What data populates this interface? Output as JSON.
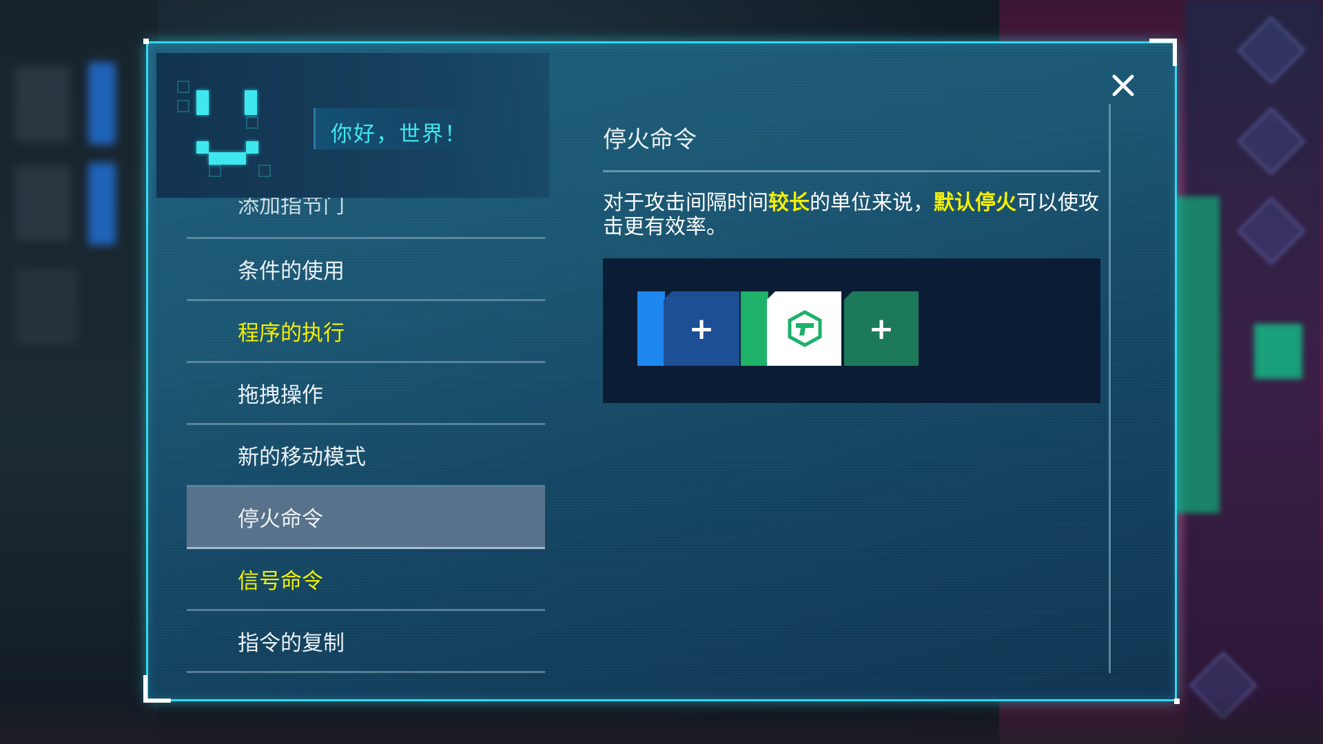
{
  "header": {
    "greeting": "你好，世界！"
  },
  "menu": {
    "items": [
      {
        "label": "添加指节门",
        "state": "cut-off"
      },
      {
        "label": "条件的使用",
        "state": "normal"
      },
      {
        "label": "程序的执行",
        "state": "highlight"
      },
      {
        "label": "拖拽操作",
        "state": "normal"
      },
      {
        "label": "新的移动模式",
        "state": "normal"
      },
      {
        "label": "停火命令",
        "state": "selected"
      },
      {
        "label": "信号命令",
        "state": "highlight"
      },
      {
        "label": "指令的复制",
        "state": "normal"
      }
    ]
  },
  "content": {
    "title": "停火命令",
    "desc_part1": "对于攻击间隔时间",
    "desc_hl1": "较长",
    "desc_part2": "的单位来说，",
    "desc_hl2": "默认停火",
    "desc_part3": "可以使攻击更有效率。"
  },
  "demo": {
    "blue_block_symbol": "+",
    "green_block_symbol": "+",
    "white_block_icon": "hold-fire-icon"
  },
  "icons": {
    "close": "close-icon",
    "mascot": "pixel-smiley-icon"
  },
  "colors": {
    "frame_accent": "#33d9ef",
    "highlight_text": "#f4f000",
    "mascot": "#3fe7ee",
    "selected_item_bg": "#58728b",
    "block_blue": "#1d4f94",
    "block_green": "#1c7a5b"
  }
}
